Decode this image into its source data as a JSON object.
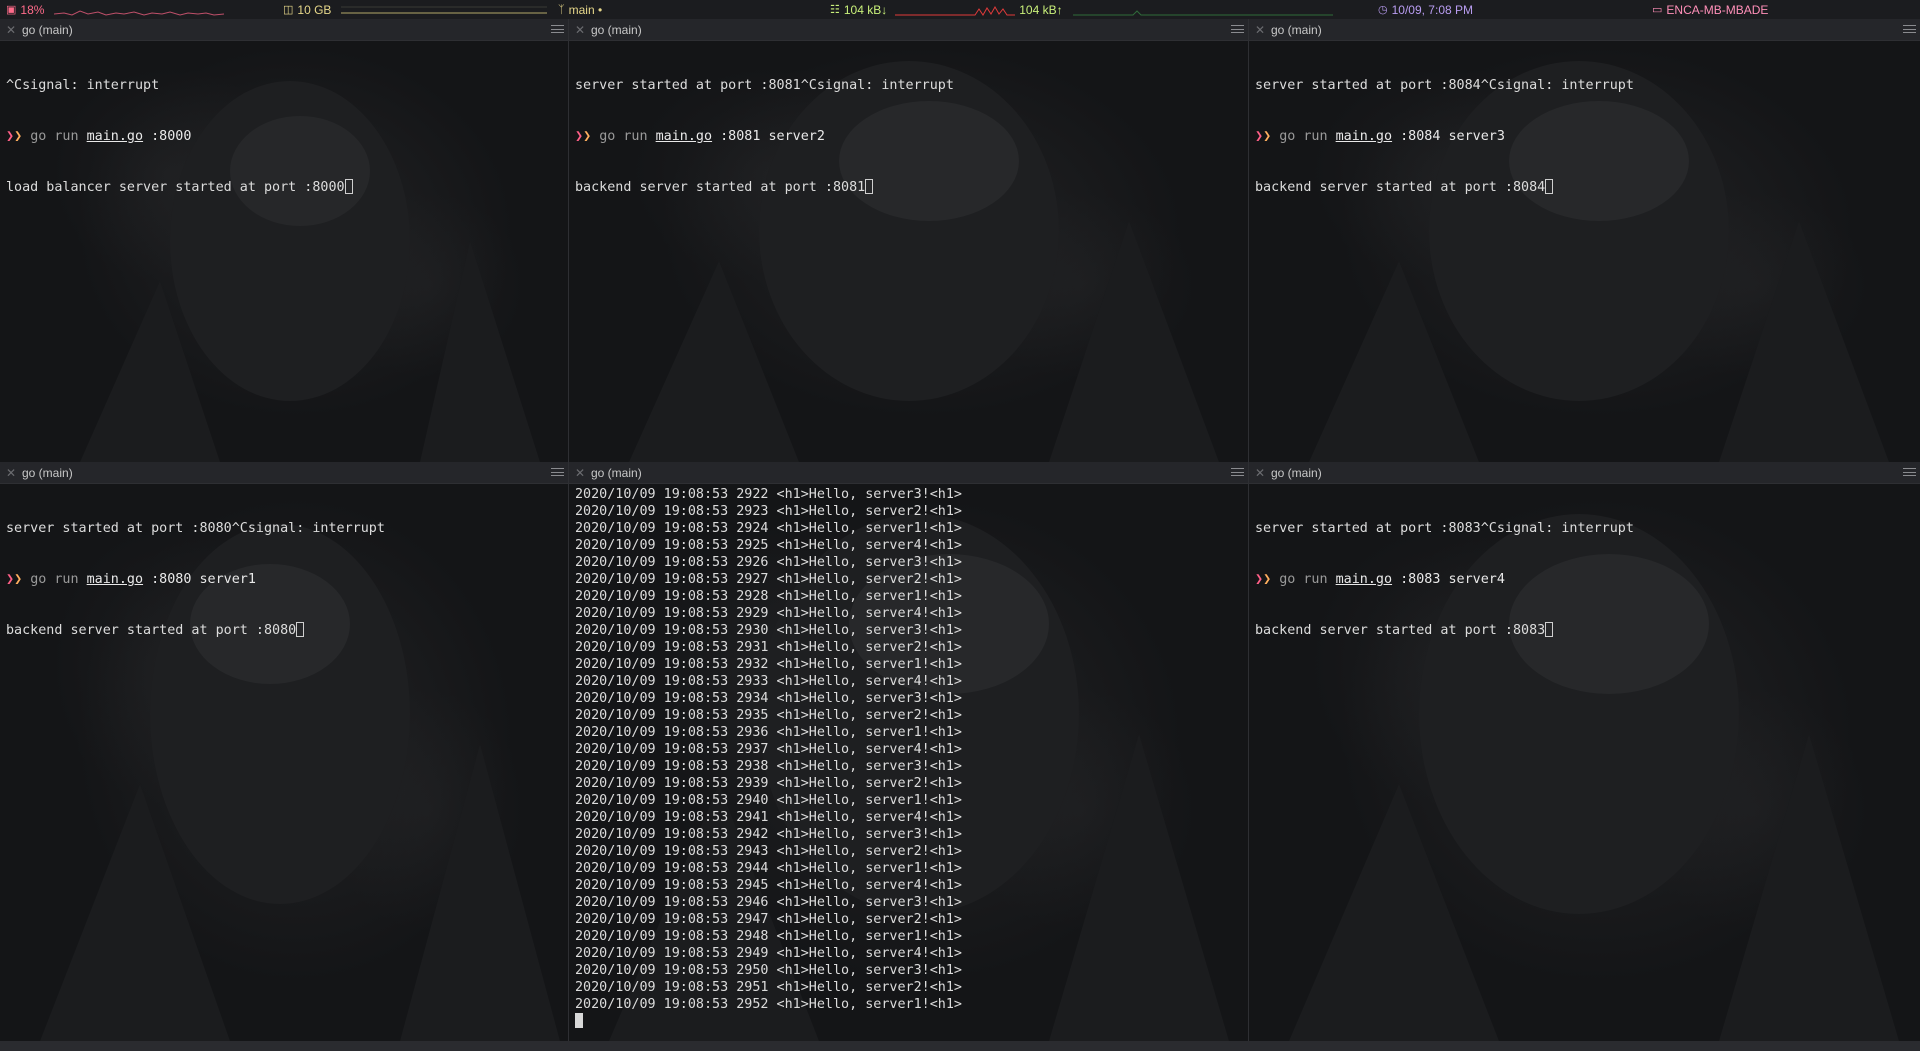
{
  "statusbar": {
    "cpu": {
      "icon": "cpu-icon",
      "value": "18%",
      "color": "#ff6b8a"
    },
    "memory": {
      "icon": "memory-icon",
      "value": "10 GB",
      "color": "#e6d78a"
    },
    "git": {
      "icon": "git-branch-icon",
      "value": "main •",
      "color": "#e6d78a"
    },
    "net_down": {
      "icon": "network-icon",
      "value": "104 kB↓",
      "color": "#c9f07a"
    },
    "net_up": {
      "value": "104 kB↑",
      "color": "#c9f07a"
    },
    "clock": {
      "icon": "clock-icon",
      "value": "10/09, 7:08 PM",
      "color": "#b89cf0"
    },
    "host": {
      "icon": "laptop-icon",
      "value": "ENCA-MB-MBADE",
      "color": "#ff8fb8"
    }
  },
  "panes": {
    "p1": {
      "title": "go (main)",
      "line0": "^Csignal: interrupt",
      "cmd_go": "go run",
      "cmd_file": "main.go",
      "cmd_args": " :8000",
      "output": "load balancer server started at port :8000"
    },
    "p2": {
      "title": "go (main)",
      "line0": "server started at port :8081^Csignal: interrupt",
      "cmd_go": "go run",
      "cmd_file": "main.go",
      "cmd_args": " :8081 server2",
      "output": "backend server started at port :8081"
    },
    "p3": {
      "title": "go (main)",
      "line0": "server started at port :8084^Csignal: interrupt",
      "cmd_go": "go run",
      "cmd_file": "main.go",
      "cmd_args": " :8084 server3",
      "output": "backend server started at port :8084"
    },
    "p4": {
      "title": "go (main)",
      "line0": "server started at port :8080^Csignal: interrupt",
      "cmd_go": "go run",
      "cmd_file": "main.go",
      "cmd_args": " :8080 server1",
      "output": "backend server started at port :8080"
    },
    "p5": {
      "title": "go (main)",
      "log": [
        "2020/10/09 19:08:53 2922 <h1>Hello, server3!<h1>",
        "2020/10/09 19:08:53 2923 <h1>Hello, server2!<h1>",
        "2020/10/09 19:08:53 2924 <h1>Hello, server1!<h1>",
        "2020/10/09 19:08:53 2925 <h1>Hello, server4!<h1>",
        "2020/10/09 19:08:53 2926 <h1>Hello, server3!<h1>",
        "2020/10/09 19:08:53 2927 <h1>Hello, server2!<h1>",
        "2020/10/09 19:08:53 2928 <h1>Hello, server1!<h1>",
        "2020/10/09 19:08:53 2929 <h1>Hello, server4!<h1>",
        "2020/10/09 19:08:53 2930 <h1>Hello, server3!<h1>",
        "2020/10/09 19:08:53 2931 <h1>Hello, server2!<h1>",
        "2020/10/09 19:08:53 2932 <h1>Hello, server1!<h1>",
        "2020/10/09 19:08:53 2933 <h1>Hello, server4!<h1>",
        "2020/10/09 19:08:53 2934 <h1>Hello, server3!<h1>",
        "2020/10/09 19:08:53 2935 <h1>Hello, server2!<h1>",
        "2020/10/09 19:08:53 2936 <h1>Hello, server1!<h1>",
        "2020/10/09 19:08:53 2937 <h1>Hello, server4!<h1>",
        "2020/10/09 19:08:53 2938 <h1>Hello, server3!<h1>",
        "2020/10/09 19:08:53 2939 <h1>Hello, server2!<h1>",
        "2020/10/09 19:08:53 2940 <h1>Hello, server1!<h1>",
        "2020/10/09 19:08:53 2941 <h1>Hello, server4!<h1>",
        "2020/10/09 19:08:53 2942 <h1>Hello, server3!<h1>",
        "2020/10/09 19:08:53 2943 <h1>Hello, server2!<h1>",
        "2020/10/09 19:08:53 2944 <h1>Hello, server1!<h1>",
        "2020/10/09 19:08:53 2945 <h1>Hello, server4!<h1>",
        "2020/10/09 19:08:53 2946 <h1>Hello, server3!<h1>",
        "2020/10/09 19:08:53 2947 <h1>Hello, server2!<h1>",
        "2020/10/09 19:08:53 2948 <h1>Hello, server1!<h1>",
        "2020/10/09 19:08:53 2949 <h1>Hello, server4!<h1>",
        "2020/10/09 19:08:53 2950 <h1>Hello, server3!<h1>",
        "2020/10/09 19:08:53 2951 <h1>Hello, server2!<h1>",
        "2020/10/09 19:08:53 2952 <h1>Hello, server1!<h1>"
      ]
    },
    "p6": {
      "title": "go (main)",
      "line0": "server started at port :8083^Csignal: interrupt",
      "cmd_go": "go run",
      "cmd_file": "main.go",
      "cmd_args": " :8083 server4",
      "output": "backend server started at port :8083"
    }
  },
  "icons": {
    "close": "close-icon",
    "menu": "hamburger-menu-icon",
    "prompt": "prompt-arrow-icon",
    "cursor": "cursor-block"
  }
}
